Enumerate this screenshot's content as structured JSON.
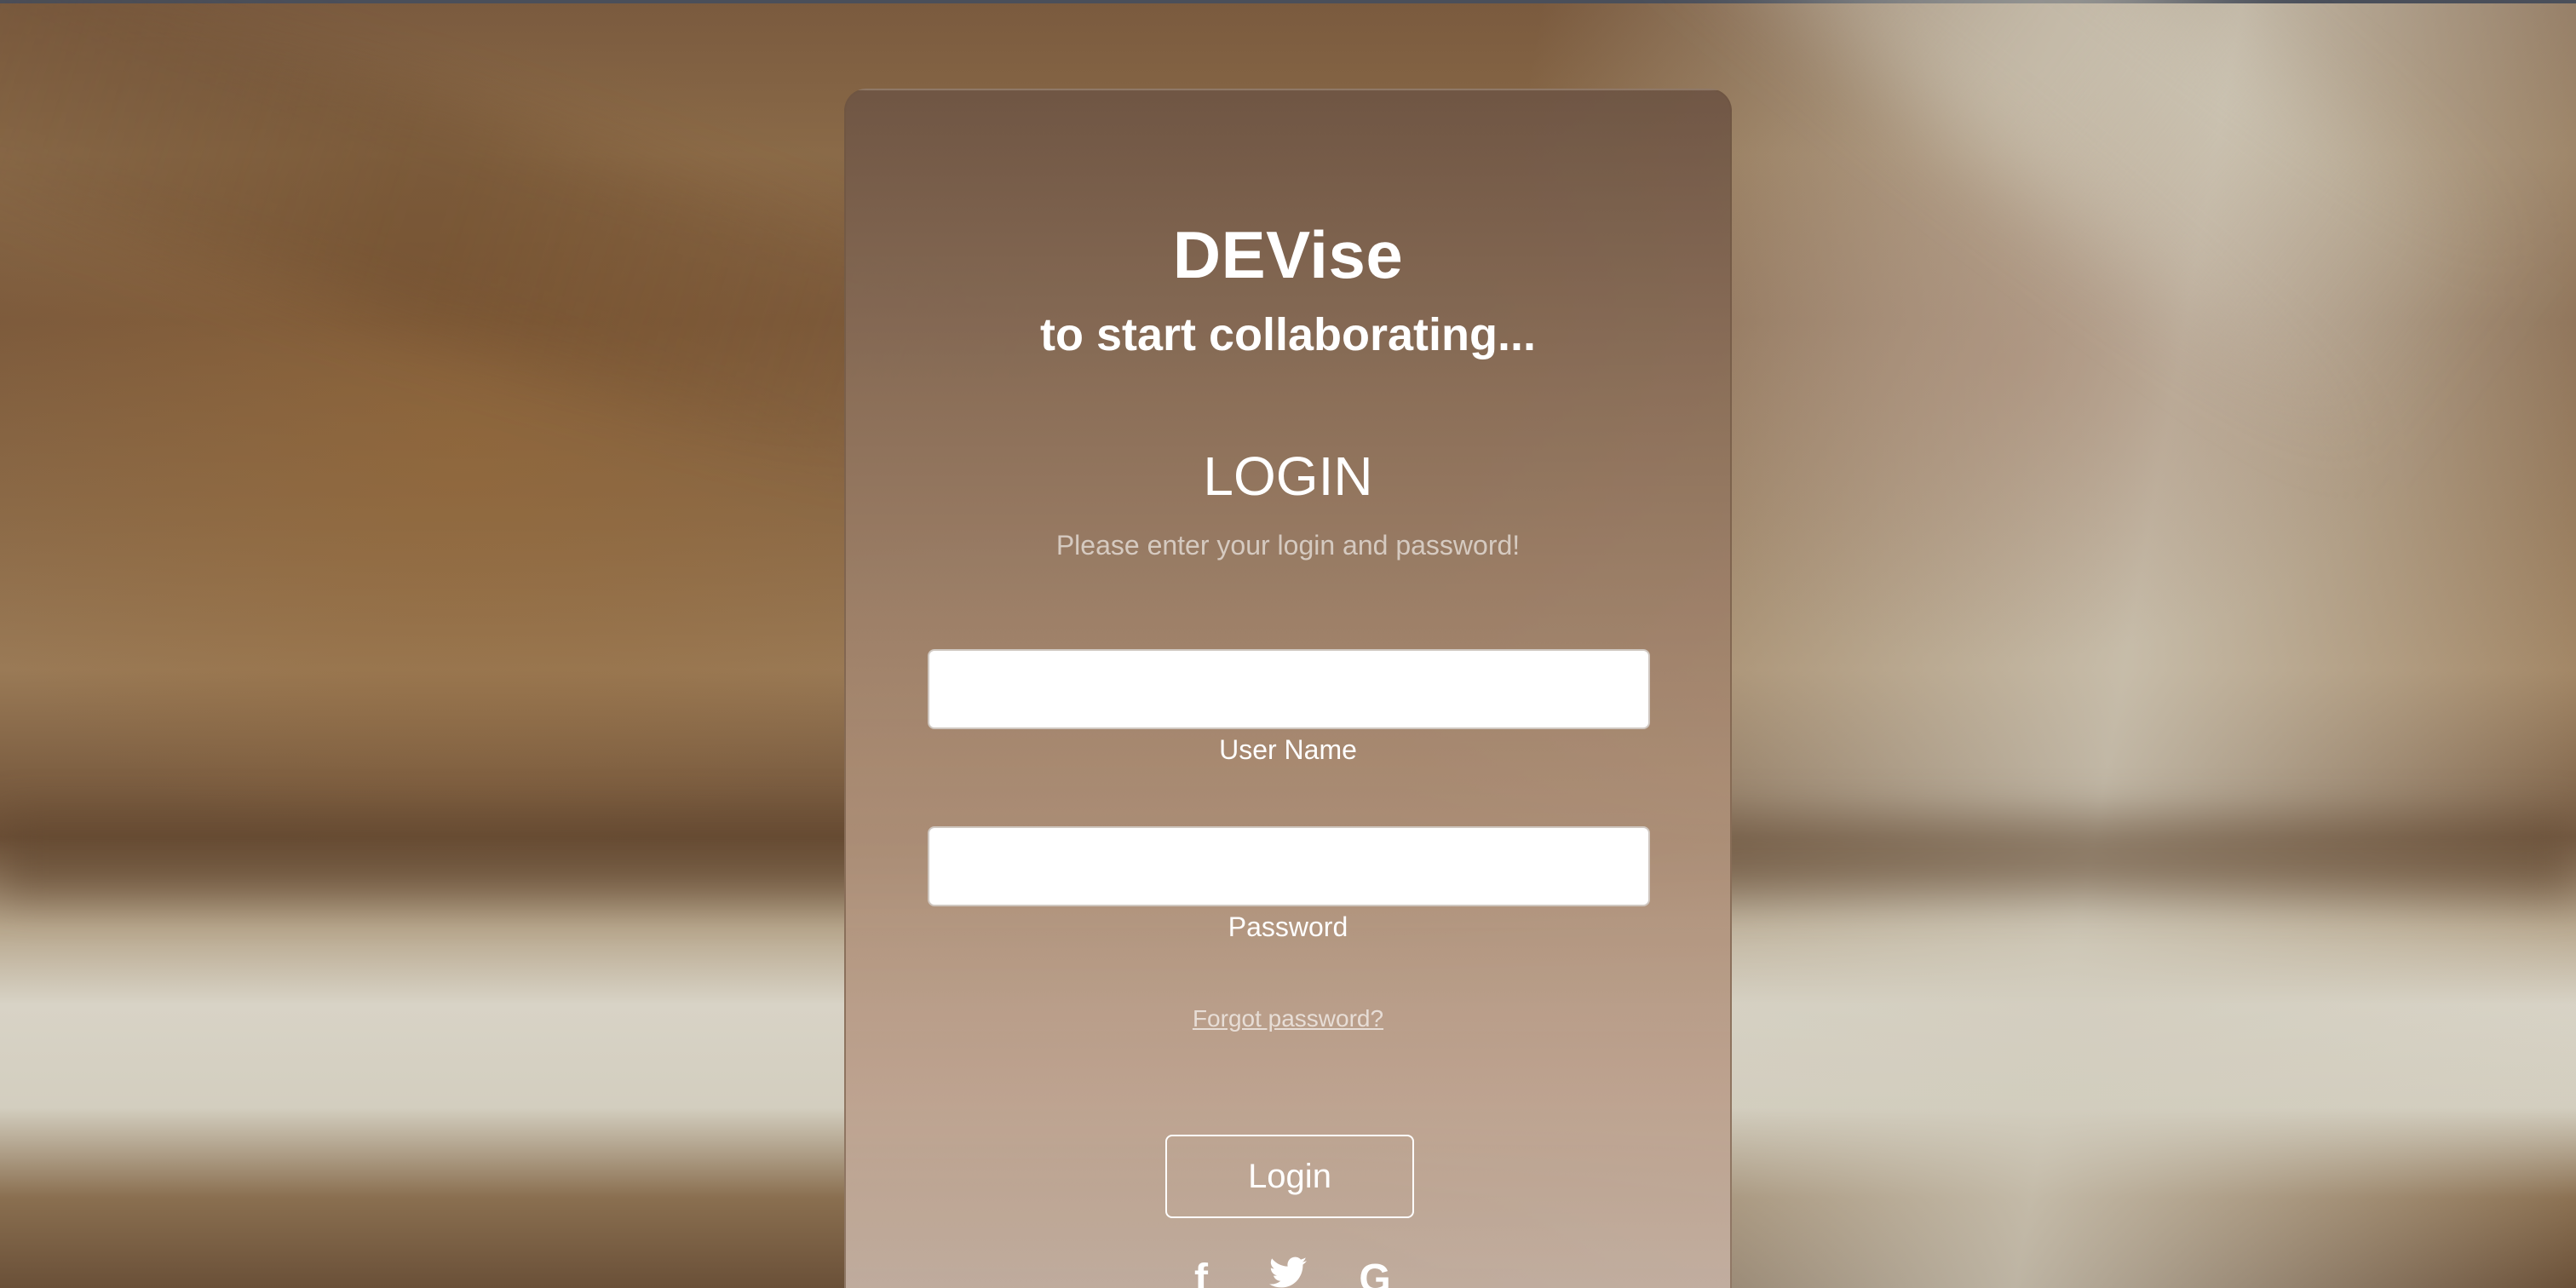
{
  "brand": {
    "name": "DEVise",
    "tagline": "to start collaborating..."
  },
  "login": {
    "title": "LOGIN",
    "subtitle": "Please enter your login and password!",
    "username_label": "User Name",
    "username_value": "",
    "password_label": "Password",
    "password_value": "",
    "forgot_link": "Forgot password?",
    "submit_label": "Login"
  },
  "social": {
    "facebook": "f",
    "twitter": "t",
    "google": "G"
  },
  "icons": [
    "facebook-icon",
    "twitter-icon",
    "google-icon"
  ]
}
